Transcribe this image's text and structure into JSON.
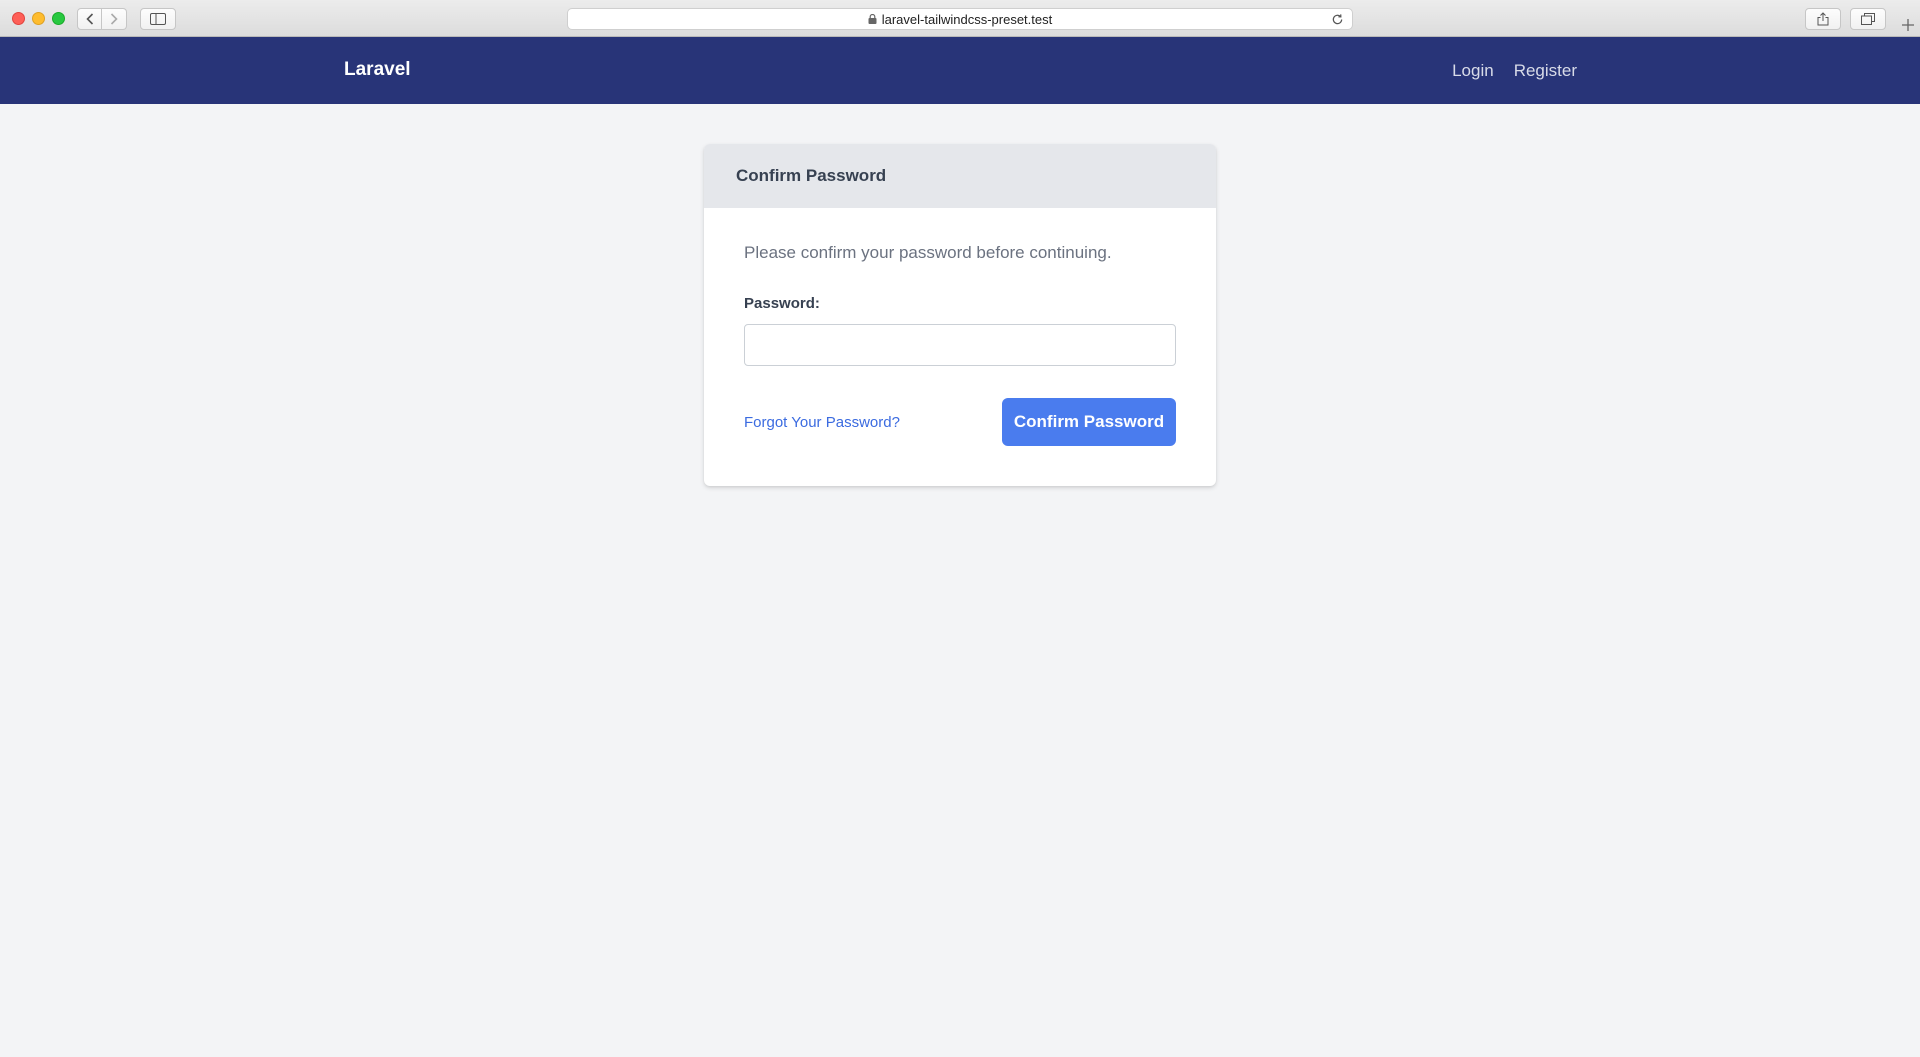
{
  "browser": {
    "url": "laravel-tailwindcss-preset.test",
    "icons": [
      "back-arrow-icon",
      "forward-arrow-icon",
      "sidebar-icon",
      "lock-icon",
      "reload-icon",
      "share-icon",
      "tabs-icon",
      "plus-icon"
    ]
  },
  "navbar": {
    "brand": "Laravel",
    "links": [
      "Login",
      "Register"
    ],
    "background_color": "#283478"
  },
  "card": {
    "header_title": "Confirm Password",
    "intro_text": "Please confirm your password before continuing.",
    "password_label": "Password:",
    "password_value": "",
    "forgot_link": "Forgot Your Password?",
    "submit_label": "Confirm Password",
    "accent_color": "#4a7cee"
  }
}
